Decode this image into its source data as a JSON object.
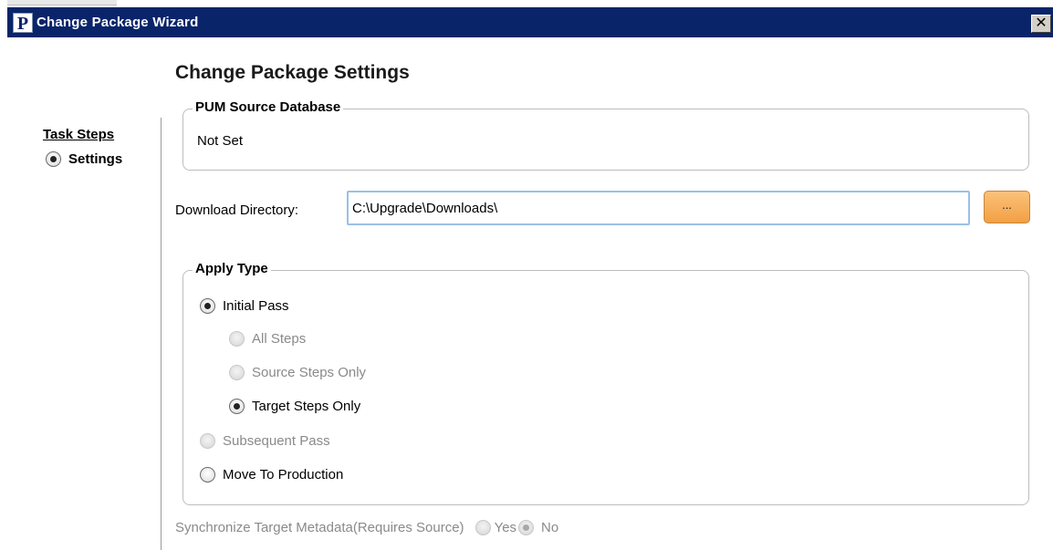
{
  "window": {
    "title": "Change Package Wizard",
    "icon_letter": "P",
    "close_label": "✕"
  },
  "page": {
    "title": "Change Package Settings"
  },
  "sidebar": {
    "heading": "Task Steps",
    "items": [
      {
        "label": "Settings",
        "selected": true
      }
    ]
  },
  "pum_source": {
    "title": "PUM Source Database",
    "value": "Not Set"
  },
  "download": {
    "label": "Download Directory:",
    "value": "C:\\Upgrade\\Downloads\\",
    "browse_label": "..."
  },
  "apply_type": {
    "title": "Apply Type",
    "options": [
      {
        "label": "Initial Pass",
        "checked": true,
        "enabled": true
      },
      {
        "label": "All Steps",
        "checked": false,
        "enabled": false
      },
      {
        "label": "Source Steps Only",
        "checked": false,
        "enabled": false
      },
      {
        "label": "Target Steps Only",
        "checked": true,
        "enabled": true
      },
      {
        "label": "Subsequent Pass",
        "checked": false,
        "enabled": false
      },
      {
        "label": "Move To Production",
        "checked": false,
        "enabled": true
      }
    ]
  },
  "sync": {
    "label": "Synchronize Target Metadata(Requires Source)",
    "yes_label": "Yes",
    "no_label": "No",
    "selected": "No",
    "enabled": false
  },
  "colors": {
    "titlebar": "#0a246a",
    "input_border": "#9cc0e4",
    "browse_button": "#f2a044",
    "disabled_text": "#8a8a8a"
  }
}
